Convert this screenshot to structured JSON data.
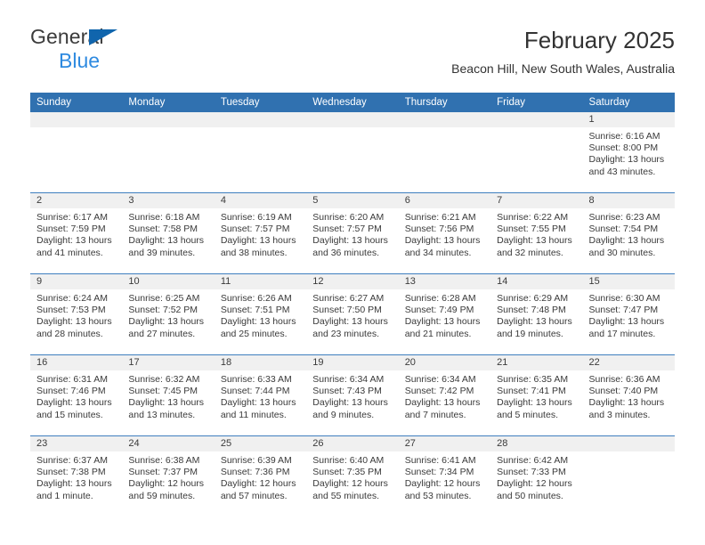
{
  "brand": {
    "line1": "General",
    "line2": "Blue",
    "triangle_color": "#1065ad",
    "line2_color": "#2e8ae0"
  },
  "header": {
    "title": "February 2025",
    "subtitle": "Beacon Hill, New South Wales, Australia"
  },
  "theme": {
    "header_blue": "#3071b0",
    "separator_blue": "#3f7fbf",
    "daynum_bg": "#f0f0f0",
    "text": "#3a3a3a"
  },
  "weekdays": [
    "Sunday",
    "Monday",
    "Tuesday",
    "Wednesday",
    "Thursday",
    "Friday",
    "Saturday"
  ],
  "labels": {
    "sunrise": "Sunrise:",
    "sunset": "Sunset:",
    "daylight": "Daylight:"
  },
  "weeks": [
    [
      {
        "day": "",
        "blank": true
      },
      {
        "day": "",
        "blank": true
      },
      {
        "day": "",
        "blank": true
      },
      {
        "day": "",
        "blank": true
      },
      {
        "day": "",
        "blank": true
      },
      {
        "day": "",
        "blank": true
      },
      {
        "day": "1",
        "sunrise": "Sunrise: 6:16 AM",
        "sunset": "Sunset: 8:00 PM",
        "daylight1": "Daylight: 13 hours",
        "daylight2": "and 43 minutes."
      }
    ],
    [
      {
        "day": "2",
        "sunrise": "Sunrise: 6:17 AM",
        "sunset": "Sunset: 7:59 PM",
        "daylight1": "Daylight: 13 hours",
        "daylight2": "and 41 minutes."
      },
      {
        "day": "3",
        "sunrise": "Sunrise: 6:18 AM",
        "sunset": "Sunset: 7:58 PM",
        "daylight1": "Daylight: 13 hours",
        "daylight2": "and 39 minutes."
      },
      {
        "day": "4",
        "sunrise": "Sunrise: 6:19 AM",
        "sunset": "Sunset: 7:57 PM",
        "daylight1": "Daylight: 13 hours",
        "daylight2": "and 38 minutes."
      },
      {
        "day": "5",
        "sunrise": "Sunrise: 6:20 AM",
        "sunset": "Sunset: 7:57 PM",
        "daylight1": "Daylight: 13 hours",
        "daylight2": "and 36 minutes."
      },
      {
        "day": "6",
        "sunrise": "Sunrise: 6:21 AM",
        "sunset": "Sunset: 7:56 PM",
        "daylight1": "Daylight: 13 hours",
        "daylight2": "and 34 minutes."
      },
      {
        "day": "7",
        "sunrise": "Sunrise: 6:22 AM",
        "sunset": "Sunset: 7:55 PM",
        "daylight1": "Daylight: 13 hours",
        "daylight2": "and 32 minutes."
      },
      {
        "day": "8",
        "sunrise": "Sunrise: 6:23 AM",
        "sunset": "Sunset: 7:54 PM",
        "daylight1": "Daylight: 13 hours",
        "daylight2": "and 30 minutes."
      }
    ],
    [
      {
        "day": "9",
        "sunrise": "Sunrise: 6:24 AM",
        "sunset": "Sunset: 7:53 PM",
        "daylight1": "Daylight: 13 hours",
        "daylight2": "and 28 minutes."
      },
      {
        "day": "10",
        "sunrise": "Sunrise: 6:25 AM",
        "sunset": "Sunset: 7:52 PM",
        "daylight1": "Daylight: 13 hours",
        "daylight2": "and 27 minutes."
      },
      {
        "day": "11",
        "sunrise": "Sunrise: 6:26 AM",
        "sunset": "Sunset: 7:51 PM",
        "daylight1": "Daylight: 13 hours",
        "daylight2": "and 25 minutes."
      },
      {
        "day": "12",
        "sunrise": "Sunrise: 6:27 AM",
        "sunset": "Sunset: 7:50 PM",
        "daylight1": "Daylight: 13 hours",
        "daylight2": "and 23 minutes."
      },
      {
        "day": "13",
        "sunrise": "Sunrise: 6:28 AM",
        "sunset": "Sunset: 7:49 PM",
        "daylight1": "Daylight: 13 hours",
        "daylight2": "and 21 minutes."
      },
      {
        "day": "14",
        "sunrise": "Sunrise: 6:29 AM",
        "sunset": "Sunset: 7:48 PM",
        "daylight1": "Daylight: 13 hours",
        "daylight2": "and 19 minutes."
      },
      {
        "day": "15",
        "sunrise": "Sunrise: 6:30 AM",
        "sunset": "Sunset: 7:47 PM",
        "daylight1": "Daylight: 13 hours",
        "daylight2": "and 17 minutes."
      }
    ],
    [
      {
        "day": "16",
        "sunrise": "Sunrise: 6:31 AM",
        "sunset": "Sunset: 7:46 PM",
        "daylight1": "Daylight: 13 hours",
        "daylight2": "and 15 minutes."
      },
      {
        "day": "17",
        "sunrise": "Sunrise: 6:32 AM",
        "sunset": "Sunset: 7:45 PM",
        "daylight1": "Daylight: 13 hours",
        "daylight2": "and 13 minutes."
      },
      {
        "day": "18",
        "sunrise": "Sunrise: 6:33 AM",
        "sunset": "Sunset: 7:44 PM",
        "daylight1": "Daylight: 13 hours",
        "daylight2": "and 11 minutes."
      },
      {
        "day": "19",
        "sunrise": "Sunrise: 6:34 AM",
        "sunset": "Sunset: 7:43 PM",
        "daylight1": "Daylight: 13 hours",
        "daylight2": "and 9 minutes."
      },
      {
        "day": "20",
        "sunrise": "Sunrise: 6:34 AM",
        "sunset": "Sunset: 7:42 PM",
        "daylight1": "Daylight: 13 hours",
        "daylight2": "and 7 minutes."
      },
      {
        "day": "21",
        "sunrise": "Sunrise: 6:35 AM",
        "sunset": "Sunset: 7:41 PM",
        "daylight1": "Daylight: 13 hours",
        "daylight2": "and 5 minutes."
      },
      {
        "day": "22",
        "sunrise": "Sunrise: 6:36 AM",
        "sunset": "Sunset: 7:40 PM",
        "daylight1": "Daylight: 13 hours",
        "daylight2": "and 3 minutes."
      }
    ],
    [
      {
        "day": "23",
        "sunrise": "Sunrise: 6:37 AM",
        "sunset": "Sunset: 7:38 PM",
        "daylight1": "Daylight: 13 hours",
        "daylight2": "and 1 minute."
      },
      {
        "day": "24",
        "sunrise": "Sunrise: 6:38 AM",
        "sunset": "Sunset: 7:37 PM",
        "daylight1": "Daylight: 12 hours",
        "daylight2": "and 59 minutes."
      },
      {
        "day": "25",
        "sunrise": "Sunrise: 6:39 AM",
        "sunset": "Sunset: 7:36 PM",
        "daylight1": "Daylight: 12 hours",
        "daylight2": "and 57 minutes."
      },
      {
        "day": "26",
        "sunrise": "Sunrise: 6:40 AM",
        "sunset": "Sunset: 7:35 PM",
        "daylight1": "Daylight: 12 hours",
        "daylight2": "and 55 minutes."
      },
      {
        "day": "27",
        "sunrise": "Sunrise: 6:41 AM",
        "sunset": "Sunset: 7:34 PM",
        "daylight1": "Daylight: 12 hours",
        "daylight2": "and 53 minutes."
      },
      {
        "day": "28",
        "sunrise": "Sunrise: 6:42 AM",
        "sunset": "Sunset: 7:33 PM",
        "daylight1": "Daylight: 12 hours",
        "daylight2": "and 50 minutes."
      },
      {
        "day": "",
        "blank": true
      }
    ]
  ]
}
